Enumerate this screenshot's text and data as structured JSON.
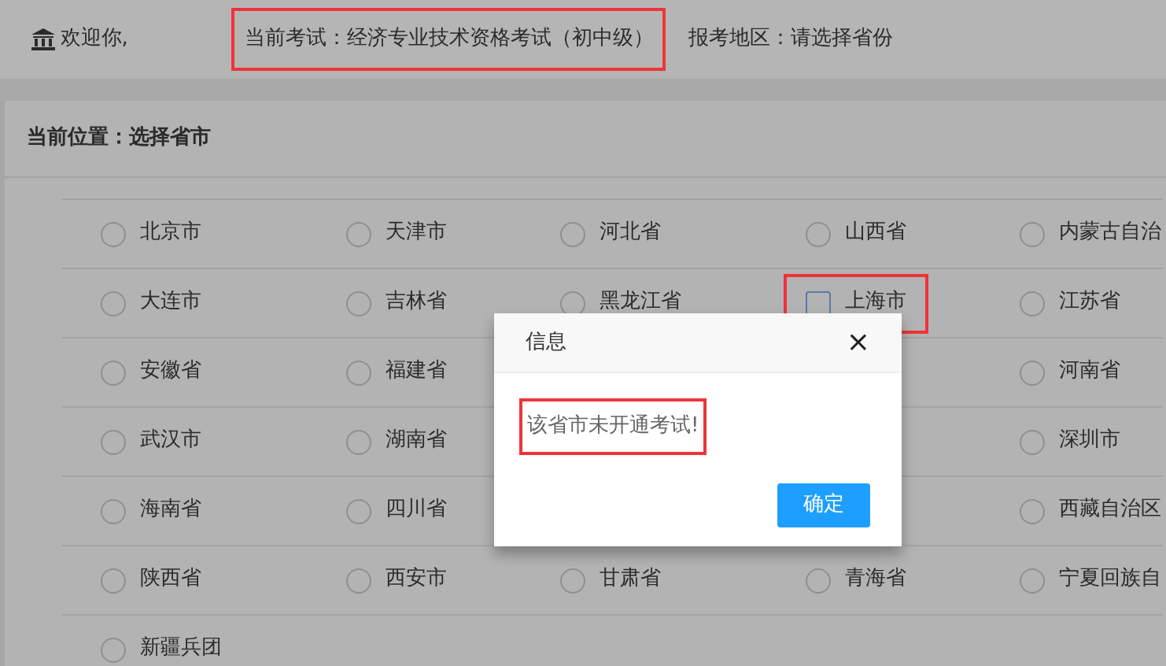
{
  "header": {
    "welcome": "欢迎你,",
    "exam": {
      "text": "当前考试：经济专业技术资格考试（初中级）",
      "highlighted": true
    },
    "region": "报考地区：请选择省份"
  },
  "breadcrumb": "当前位置：选择省市",
  "regions": [
    {
      "covered": false,
      "cells": [
        {
          "label": "北京市",
          "focused": false,
          "highlighted": false
        },
        {
          "label": "天津市",
          "focused": false,
          "highlighted": false
        },
        {
          "label": "河北省",
          "focused": false,
          "highlighted": false
        },
        {
          "label": "山西省",
          "focused": false,
          "highlighted": false
        },
        {
          "label": "内蒙古自治",
          "focused": false,
          "highlighted": false
        }
      ]
    },
    {
      "covered": false,
      "cells": [
        {
          "label": "大连市",
          "focused": false,
          "highlighted": false
        },
        {
          "label": "吉林省",
          "focused": false,
          "highlighted": false
        },
        {
          "label": "黑龙江省",
          "focused": false,
          "highlighted": false
        },
        {
          "label": "上海市",
          "focused": true,
          "highlighted": true
        },
        {
          "label": "江苏省",
          "focused": false,
          "highlighted": false
        }
      ]
    },
    {
      "covered": true,
      "cells": [
        {
          "label": "安徽省",
          "focused": false,
          "highlighted": false
        },
        {
          "label": "福建省",
          "focused": false,
          "highlighted": false
        },
        {
          "label": "河南省",
          "focused": false,
          "highlighted": false
        }
      ]
    },
    {
      "covered": true,
      "cells": [
        {
          "label": "武汉市",
          "focused": false,
          "highlighted": false
        },
        {
          "label": "湖南省",
          "focused": false,
          "highlighted": false
        },
        {
          "label": "深圳市",
          "focused": false,
          "highlighted": false
        }
      ]
    },
    {
      "covered": true,
      "cells": [
        {
          "label": "海南省",
          "focused": false,
          "highlighted": false
        },
        {
          "label": "四川省",
          "focused": false,
          "highlighted": false
        },
        {
          "label": "西藏自治区",
          "focused": false,
          "highlighted": false
        }
      ]
    },
    {
      "covered": false,
      "cells": [
        {
          "label": "陕西省",
          "focused": false,
          "highlighted": false
        },
        {
          "label": "西安市",
          "focused": false,
          "highlighted": false
        },
        {
          "label": "甘肃省",
          "focused": false,
          "highlighted": false
        },
        {
          "label": "青海省",
          "focused": false,
          "highlighted": false
        },
        {
          "label": "宁夏回族自",
          "focused": false,
          "highlighted": false
        }
      ]
    },
    {
      "cells": [
        {
          "label": "新疆兵团",
          "focused": false,
          "highlighted": false
        }
      ]
    }
  ],
  "dialog": {
    "title": "信息",
    "close": "×",
    "message": {
      "text": "该省市未开通考试!",
      "highlighted": true
    },
    "button": "确定"
  }
}
